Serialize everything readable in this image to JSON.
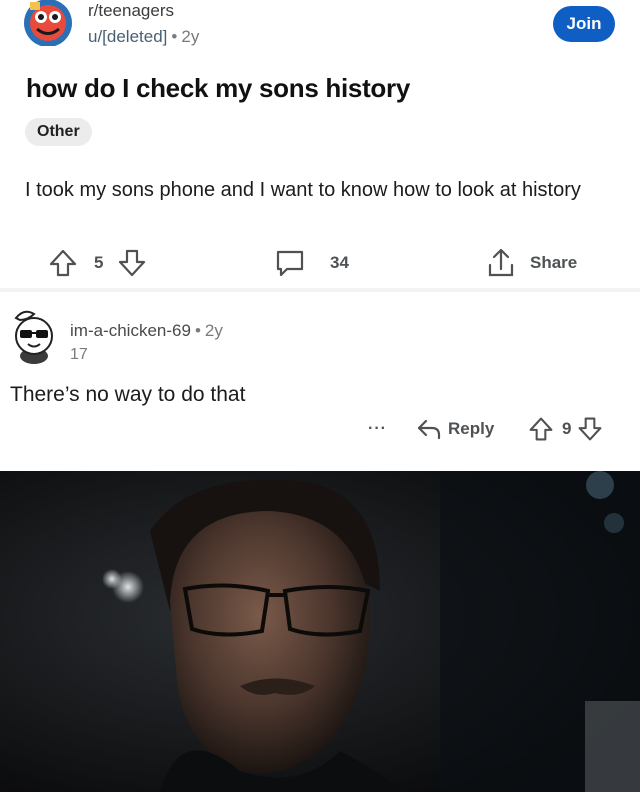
{
  "post": {
    "subreddit": "r/teenagers",
    "author": "u/[deleted]",
    "age": "2y",
    "join_label": "Join",
    "title": "how do I check my sons history",
    "flair": "Other",
    "body": "I took my sons phone and I want to know how to look at history",
    "upvotes": "5",
    "comments": "34",
    "share_label": "Share"
  },
  "comment": {
    "username": "im-a-chicken-69",
    "age": "2y",
    "score_line": "17",
    "text": "There’s no way to do that",
    "more_label": "···",
    "reply_label": "Reply",
    "votes": "9"
  },
  "colors": {
    "join_button": "#0f5ec4",
    "author_link": "#4a5f72",
    "photo_background": "#0e0f10"
  },
  "icons": [
    "subreddit-avatar-icon",
    "upvote-icon",
    "downvote-icon",
    "comment-icon",
    "share-icon",
    "user-avatar-icon",
    "more-icon",
    "reply-icon"
  ]
}
